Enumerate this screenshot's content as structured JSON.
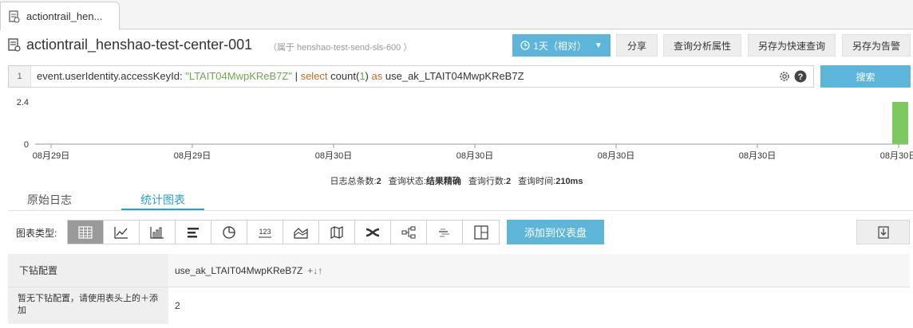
{
  "tab": {
    "label": "actiontrail_hen..."
  },
  "header": {
    "title": "actiontrail_henshao-test-center-001",
    "subtitle": "（属于 henshao-test-send-sls-600 ）",
    "time_button": "1天（相对）",
    "share": "分享",
    "query_props": "查询分析属性",
    "save_quick": "另存为快速查询",
    "save_alert": "另存为告警"
  },
  "query": {
    "line_number": "1",
    "field": "event.userIdentity.accessKeyId:",
    "value": "\"LTAIT04MwpKReB7Z\"",
    "pipe": "|",
    "select": "select",
    "func": "count(",
    "arg": "1",
    "close": ")",
    "as": "as",
    "alias": "use_ak_LTAIT04MwpKReB7Z",
    "search_button": "搜索"
  },
  "histogram": {
    "y_ticks": [
      "2.4",
      "0"
    ],
    "x_labels": [
      "08月29日",
      "08月29日",
      "08月30日",
      "08月30日",
      "08月30日",
      "08月30日",
      "08月30日"
    ],
    "bars": [
      {
        "bucket": "08月30日",
        "value": 2.4
      }
    ],
    "bar_color": "#7cc95f"
  },
  "stats": {
    "total_label": "日志总条数:",
    "total_value": "2",
    "status_label": "查询状态:",
    "status_value": "结果精确",
    "rows_label": "查询行数:",
    "rows_value": "2",
    "time_label": "查询时间:",
    "time_value": "210ms"
  },
  "subtabs": {
    "raw": "原始日志",
    "chart": "统计图表"
  },
  "chart_types": {
    "label": "图表类型:",
    "items": [
      "table",
      "line",
      "bar",
      "horizontal-bar",
      "pie",
      "number",
      "area",
      "map",
      "flow",
      "tree",
      "wordcloud",
      "layout"
    ],
    "number_text": "123",
    "add_dashboard": "添加到仪表盘"
  },
  "table": {
    "drill_header": "下钻配置",
    "column": "use_ak_LTAIT04MwpKReB7Z",
    "sort_icons": "+↓↑",
    "drill_empty": "暂无下钻配置，请使用表头上的＋添加",
    "value": "2"
  },
  "colors": {
    "accent": "#5db6d9",
    "active_tab": "#2a9fd6",
    "string": "#6aa84f",
    "keyword": "#c46a2a"
  }
}
